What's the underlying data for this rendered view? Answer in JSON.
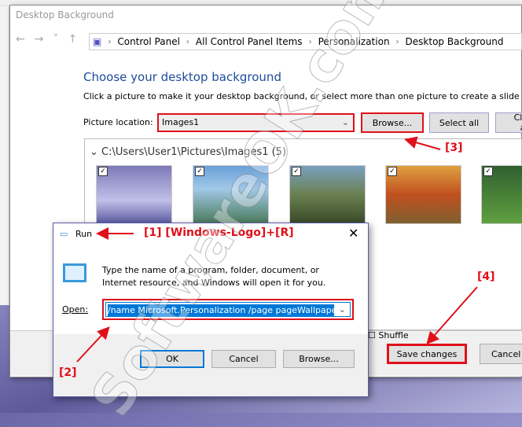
{
  "window": {
    "title": "Desktop Background",
    "breadcrumb": [
      "Control Panel",
      "All Control Panel Items",
      "Personalization",
      "Desktop Background"
    ],
    "heading": "Choose your desktop background",
    "description": "Click a picture to make it your desktop background, or select more than one picture to create a slide show.",
    "picture_location_label": "Picture location:",
    "picture_location_value": "Images1",
    "browse": "Browse...",
    "select_all": "Select all",
    "clear_all": "Clear all",
    "folder": "C:\\Users\\User1\\Pictures\\Images1 (5)",
    "shuffle": "Shuffle",
    "save": "Save changes",
    "cancel": "Cancel"
  },
  "run": {
    "title": "Run",
    "description": "Type the name of a program, folder, document, or Internet resource, and Windows will open it for you.",
    "open_label": "Open:",
    "open_value": "/name Microsoft.Personalization /page pageWallpaper",
    "ok": "OK",
    "cancel": "Cancel",
    "browse": "Browse..."
  },
  "annotations": {
    "a1": "[1]",
    "a1_keys": "[Windows-Logo]+[R]",
    "a2": "[2]",
    "a3": "[3]",
    "a4": "[4]"
  },
  "watermark": "SoftwareOK.com",
  "colors": {
    "annotation": "#e0101a",
    "heading": "#1e4c9a",
    "selection": "#0078d7"
  }
}
